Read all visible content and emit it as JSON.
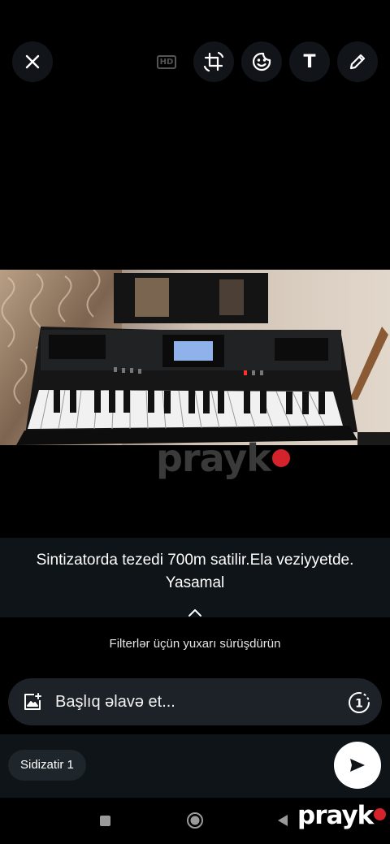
{
  "toolbar": {
    "hd_label": "HD",
    "text_tool_label": "T"
  },
  "caption": {
    "text": "Sintizatorda tezedi 700m satilir.Ela veziyyetde.\nYasamal"
  },
  "filter_hint": "Filterlər üçün yuxarı sürüşdürün",
  "input": {
    "placeholder": "Başlıq əlavə et..."
  },
  "view_once_label": "1",
  "recipient": {
    "label": "Sidizatir 1"
  },
  "watermark": {
    "text": "prayk"
  },
  "colors": {
    "brand_dot": "#d4232b",
    "panel": "#0e1418",
    "input_bg": "#1c2227"
  },
  "icons": [
    "close-icon",
    "hd-icon",
    "crop-rotate-icon",
    "sticker-icon",
    "text-icon",
    "pencil-icon",
    "chevron-up-icon",
    "add-media-icon",
    "view-once-icon",
    "send-icon",
    "nav-recents-icon",
    "nav-home-icon",
    "nav-back-icon"
  ]
}
